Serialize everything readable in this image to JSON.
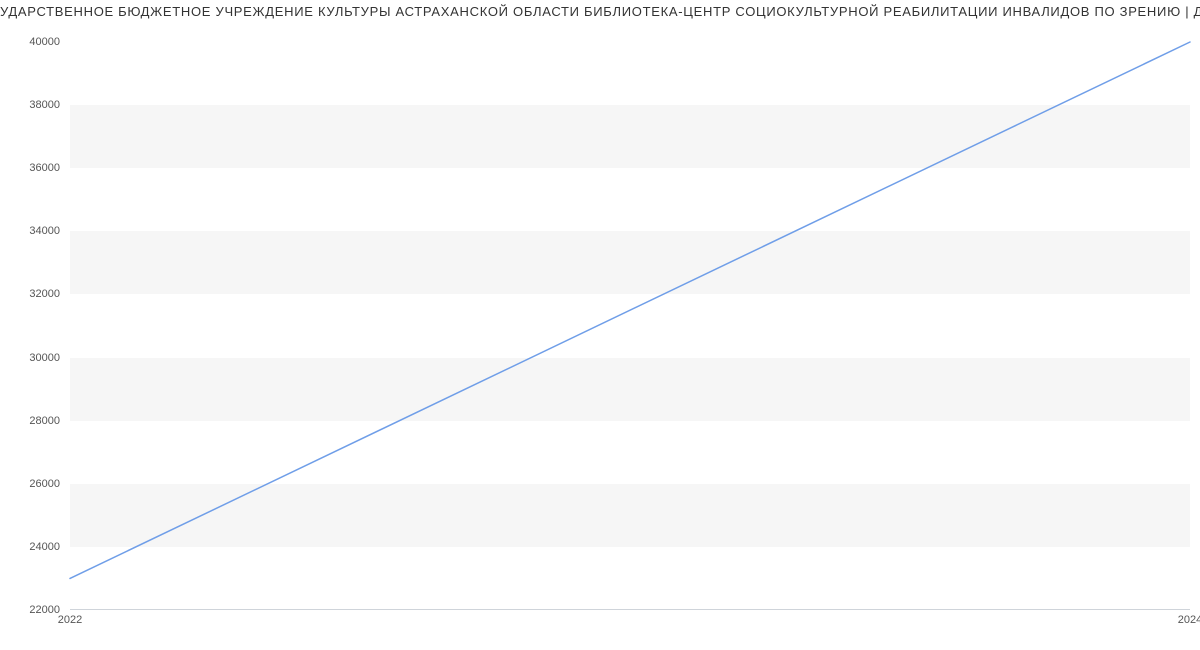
{
  "chart_data": {
    "type": "line",
    "title": "УДАРСТВЕННОЕ БЮДЖЕТНОЕ УЧРЕЖДЕНИЕ КУЛЬТУРЫ АСТРАХАНСКОЙ ОБЛАСТИ БИБЛИОТЕКА-ЦЕНТР СОЦИОКУЛЬТУРНОЙ РЕАБИЛИТАЦИИ ИНВАЛИДОВ ПО ЗРЕНИЮ | Да",
    "x": [
      2022,
      2024
    ],
    "values": [
      23000,
      40000
    ],
    "xlabel": "",
    "ylabel": "",
    "xlim": [
      2022,
      2024
    ],
    "ylim": [
      22000,
      40000
    ],
    "y_ticks": [
      22000,
      24000,
      26000,
      28000,
      30000,
      32000,
      34000,
      36000,
      38000,
      40000
    ],
    "x_ticks": [
      2022,
      2024
    ],
    "line_color": "#6f9ee8"
  }
}
